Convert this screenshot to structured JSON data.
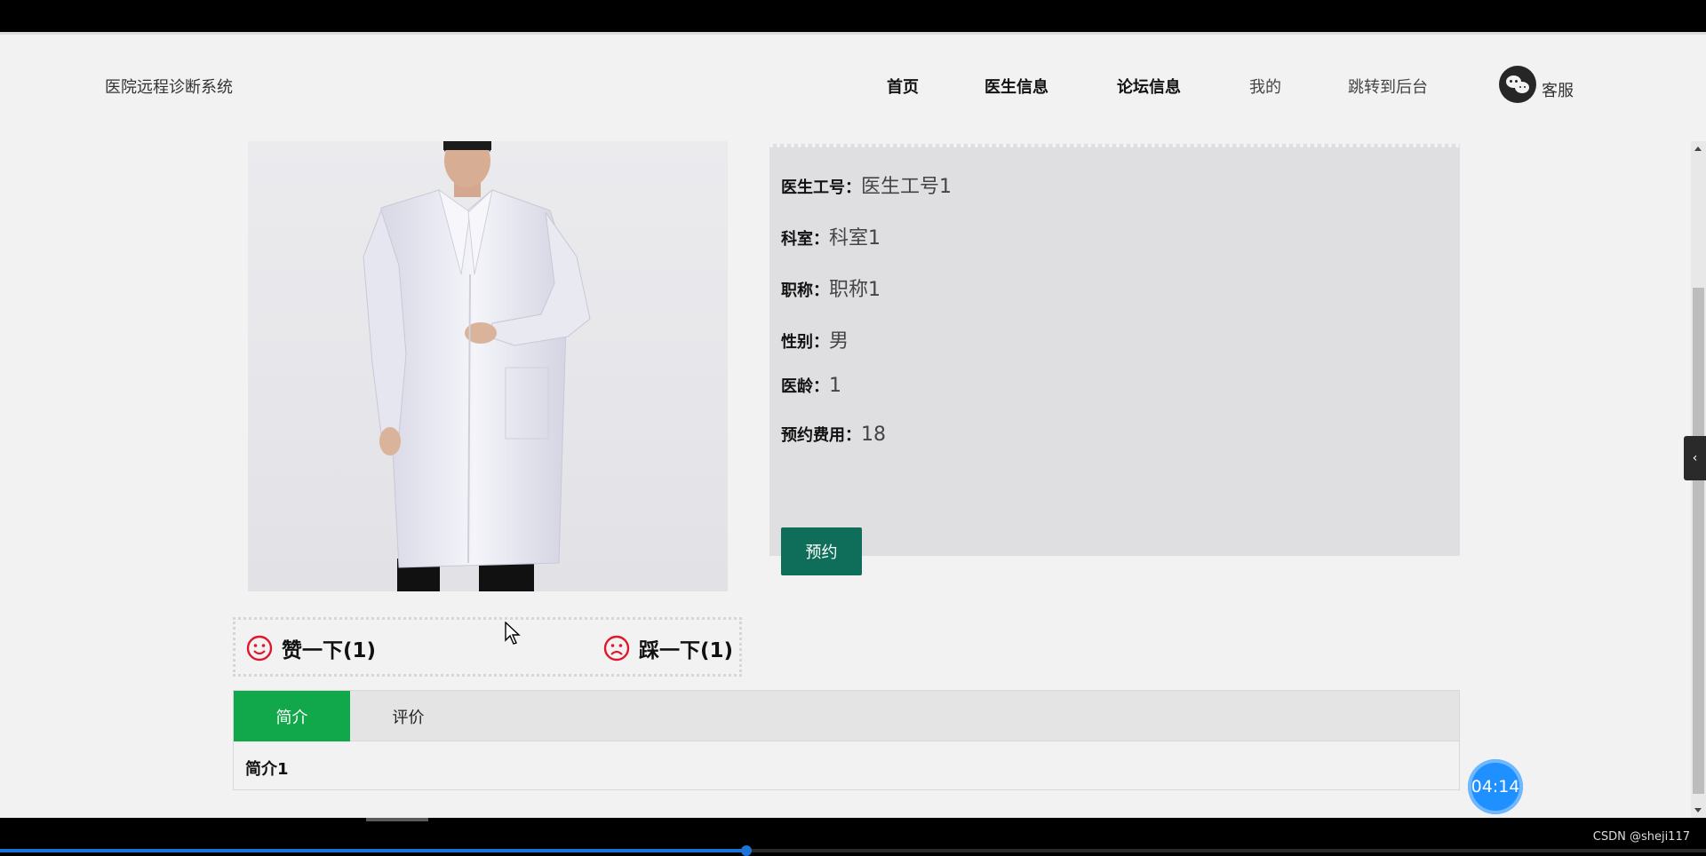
{
  "header": {
    "brand": "医院远程诊断系统",
    "nav": [
      {
        "label": "首页",
        "name": "nav-home"
      },
      {
        "label": "医生信息",
        "name": "nav-doctor-info"
      },
      {
        "label": "论坛信息",
        "name": "nav-forum-info"
      },
      {
        "label": "我的",
        "name": "nav-mine"
      },
      {
        "label": "跳转到后台",
        "name": "nav-admin"
      }
    ],
    "service_label": "客服",
    "service_icon": "wechat-icon"
  },
  "doctor": {
    "photo_alt": "doctor-photo",
    "fields": [
      {
        "key": "医生工号：",
        "value": "医生工号1"
      },
      {
        "key": "科室：",
        "value": "科室1"
      },
      {
        "key": "职称：",
        "value": "职称1"
      },
      {
        "key": "性别：",
        "value": "男"
      },
      {
        "key": "医龄：",
        "value": "1"
      },
      {
        "key": "预约费用：",
        "value": "18"
      }
    ],
    "book_label": "预约"
  },
  "votes": {
    "like_label": "赞一下(1)",
    "dislike_label": "踩一下(1)",
    "like_icon": "smile-icon",
    "dislike_icon": "frown-icon"
  },
  "tabs": {
    "items": [
      {
        "label": "简介",
        "active": true
      },
      {
        "label": "评价",
        "active": false
      }
    ],
    "content": "简介1"
  },
  "overlay": {
    "timer": "04:14",
    "credit": "CSDN @sheji117",
    "video_progress": 0.4375
  },
  "colors": {
    "accent_green": "#10a84a",
    "book_button": "#0e6e5a",
    "vote_icon_red": "#e0162b",
    "timer_blue": "#1e90ff"
  }
}
